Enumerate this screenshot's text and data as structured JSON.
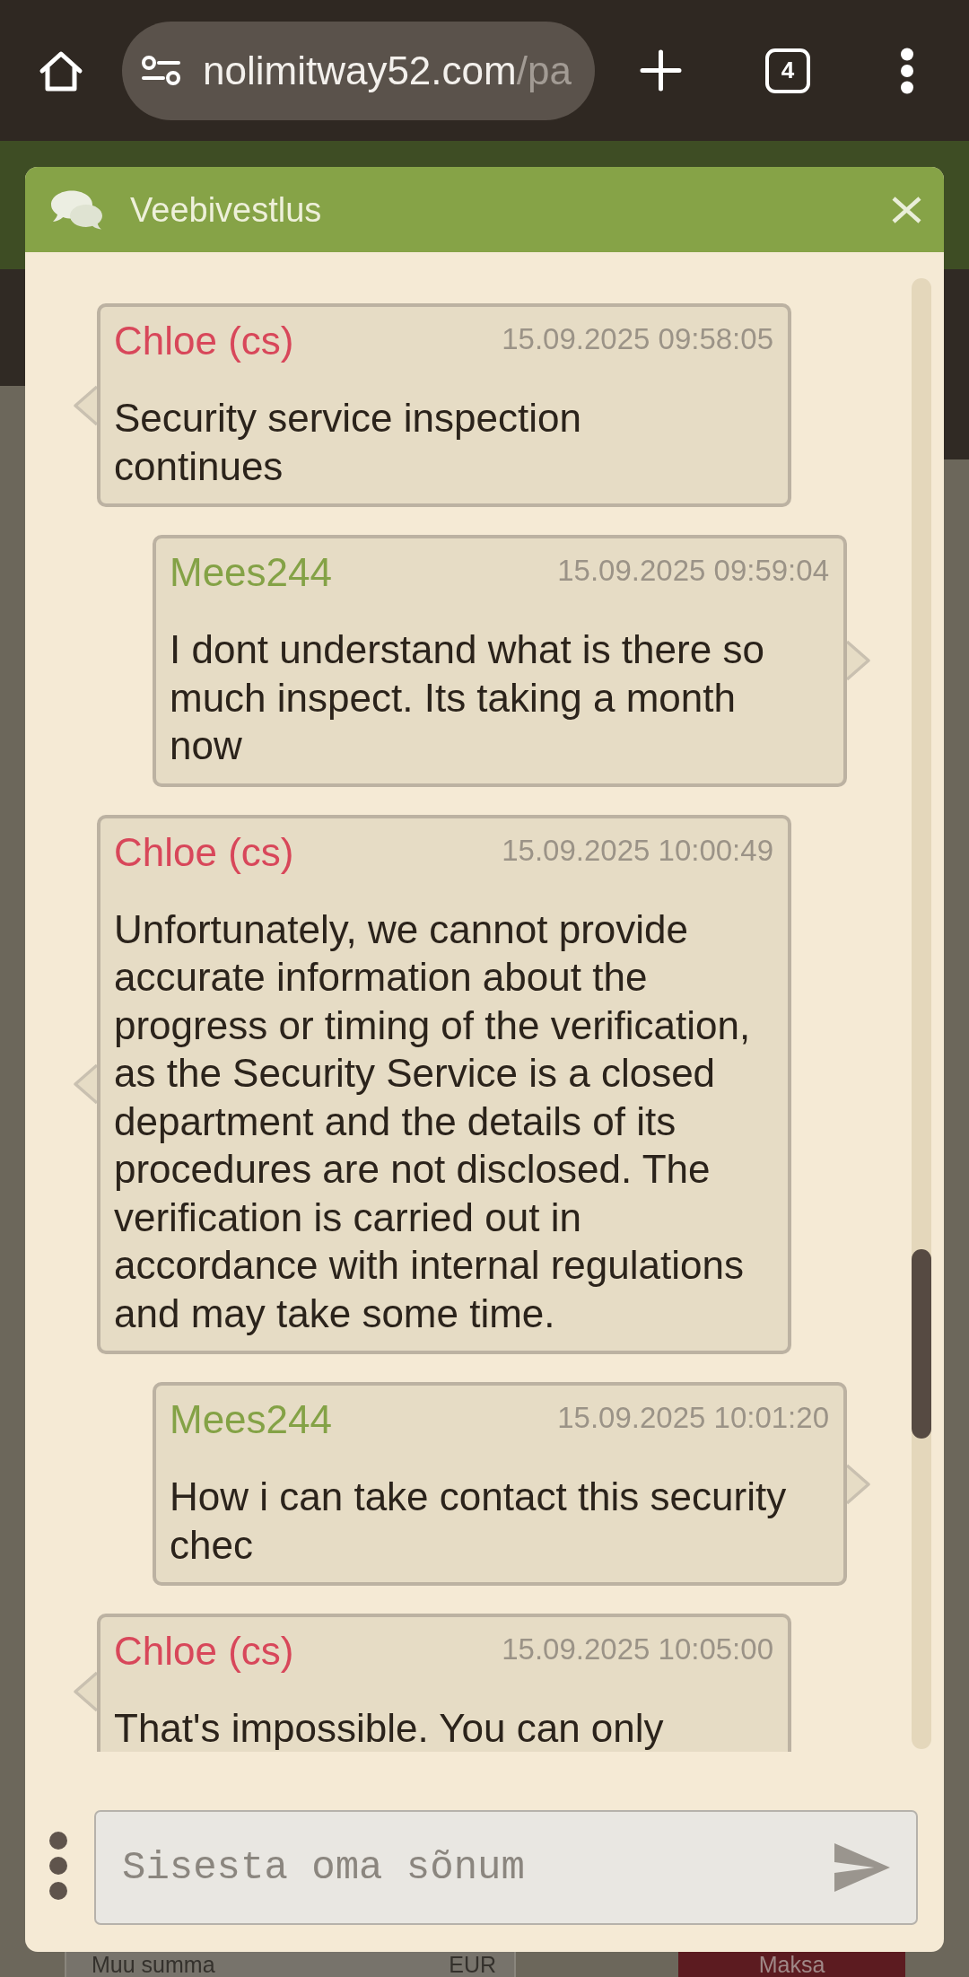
{
  "browser": {
    "address": {
      "host": "nolimitway52.com",
      "path": "/pa"
    },
    "tab_count": "4"
  },
  "page_behind": {
    "amount_field": {
      "placeholder": "Muu summa",
      "unit": "EUR"
    },
    "pay_button": "Maksa"
  },
  "chat": {
    "title": "Veebivestlus",
    "messages": [
      {
        "kind": "agent",
        "sender": "Chloe (cs)",
        "time": "15.09.2025 09:58:05",
        "text": "Security service inspection continues"
      },
      {
        "kind": "user",
        "sender": "Mees244",
        "time": "15.09.2025 09:59:04",
        "text": "I dont understand what is there so much inspect. Its taking a month now"
      },
      {
        "kind": "agent",
        "sender": "Chloe (cs)",
        "time": "15.09.2025 10:00:49",
        "text": "Unfortunately, we cannot provide accurate information about the progress or timing of the verification, as the Security Service is a closed department and the details of its procedures are not disclosed. The verification is carried out in accordance with internal regulations and may take some time."
      },
      {
        "kind": "user",
        "sender": "Mees244",
        "time": "15.09.2025 10:01:20",
        "text": "How i can take contact this security chec"
      },
      {
        "kind": "agent",
        "sender": "Chloe (cs)",
        "time": "15.09.2025 10:05:00",
        "text": "That's impossible. You can only"
      }
    ],
    "composer": {
      "placeholder": "Sisesta oma sõnum"
    }
  }
}
